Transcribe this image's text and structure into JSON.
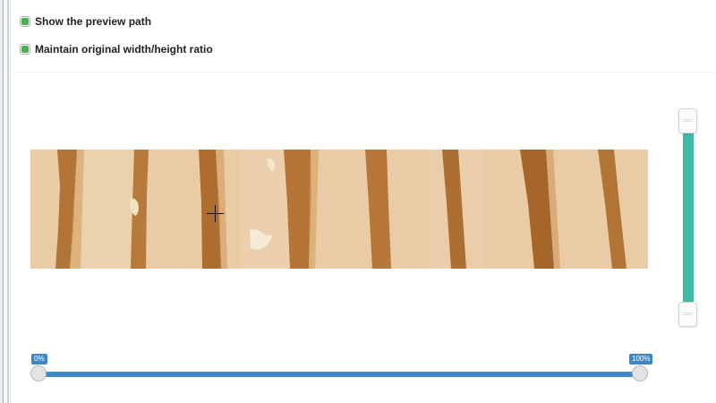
{
  "options": {
    "show_preview_path": {
      "label": "Show the preview path",
      "checked": true
    },
    "maintain_ratio": {
      "label": "Maintain original width/height ratio",
      "checked": true
    }
  },
  "range_slider": {
    "min_label": "0%",
    "max_label": "100%",
    "min_value": 0,
    "max_value": 100
  },
  "colors": {
    "checkbox_fill": "#4caf50",
    "range_accent": "#3f88c5",
    "vertical_slider_accent": "#3ebaa6"
  },
  "icons": {
    "cursor": "crosshair-cursor-icon"
  }
}
